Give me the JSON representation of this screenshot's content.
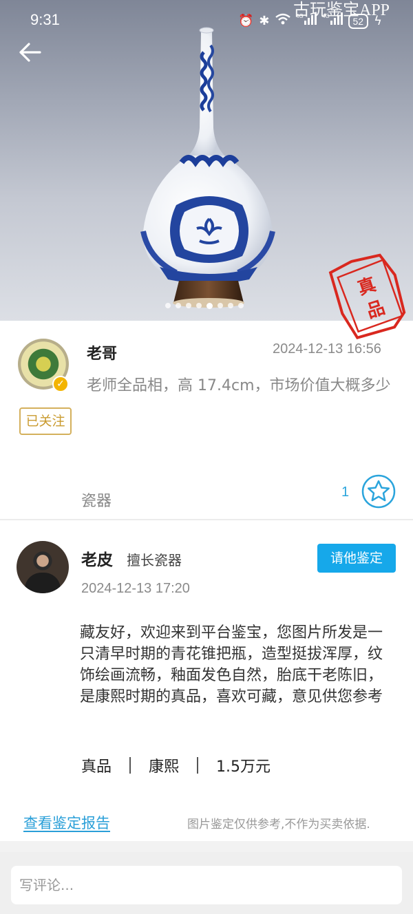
{
  "status_bar": {
    "time": "9:31",
    "battery": "52"
  },
  "hero": {
    "watermark": "古玩鉴宝APP",
    "image_count": 8,
    "active_index": 4,
    "stamp_text": "真品",
    "stamp_color": "#d9281f"
  },
  "post": {
    "username": "老哥",
    "timestamp": "2024-12-13 16:56",
    "follow_label": "已关注",
    "text": "老师全品相，高 17.4cm，市场价值大概多少",
    "category": "瓷器",
    "like_count": "1",
    "accent_color": "#2aa4dc"
  },
  "appraisal": {
    "expert_name": "老皮",
    "expert_title": "擅长瓷器",
    "invite_label": "请他鉴定",
    "timestamp": "2024-12-13 17:20",
    "text": "藏友好，欢迎来到平台鉴宝，您图片所发是一只清早时期的青花锥把瓶，造型挺拔浑厚，纹饰绘画流畅，釉面发色自然，胎底干老陈旧，是康熙时期的真品，喜欢可藏，意见供您参考",
    "verdict": {
      "authenticity": "真品",
      "period": "康熙",
      "value": "1.5万元"
    },
    "report_link": "查看鉴定报告",
    "disclaimer": "图片鉴定仅供参考,不作为买卖依据."
  },
  "comment": {
    "placeholder": "写评论..."
  }
}
